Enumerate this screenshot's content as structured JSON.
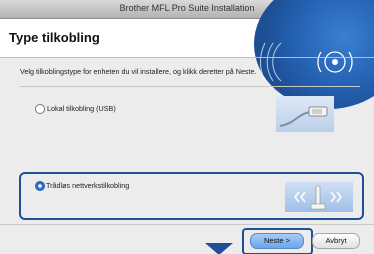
{
  "window": {
    "title": "Brother MFL Pro Suite Installation"
  },
  "header": {
    "title": "Type tilkobling"
  },
  "instruction": "Velg tilkoblingstype for enheten du vil installere, og klikk deretter på Neste.",
  "options": [
    {
      "label": "Lokal tilkobling (USB)",
      "selected": false,
      "icon": "usb-cable-icon"
    },
    {
      "label": "Trådløs nettverkstilkobling",
      "selected": true,
      "icon": "wireless-network-icon"
    }
  ],
  "buttons": {
    "next": "Neste >",
    "cancel": "Avbryt"
  },
  "colors": {
    "accent": "#1f4f96",
    "brand": "#2563b5"
  }
}
